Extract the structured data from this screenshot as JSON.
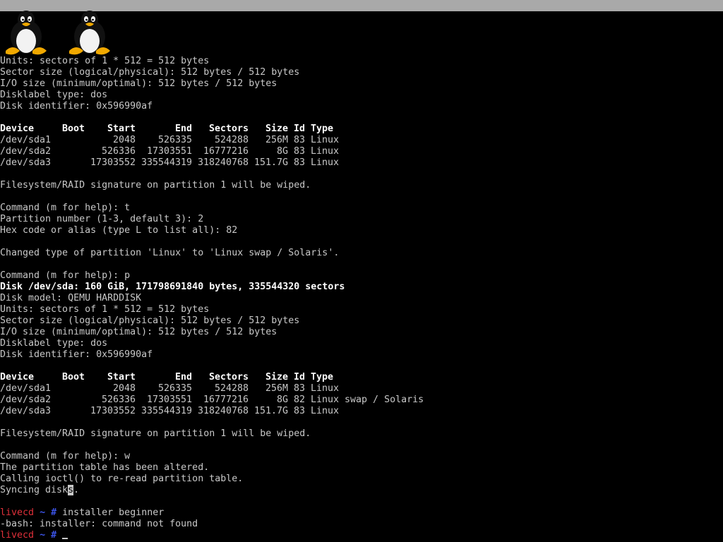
{
  "logos": [
    "tux-icon",
    "tux-icon"
  ],
  "block1": {
    "units": "Units: sectors of 1 * 512 = 512 bytes",
    "sector_size": "Sector size (logical/physical): 512 bytes / 512 bytes",
    "io_size": "I/O size (minimum/optimal): 512 bytes / 512 bytes",
    "disklabel": "Disklabel type: dos",
    "identifier": "Disk identifier: 0x596990af"
  },
  "table_header": {
    "device": "Device",
    "boot": "Boot",
    "start": "Start",
    "end": "End",
    "sectors": "Sectors",
    "size": "Size",
    "id": "Id",
    "type": "Type"
  },
  "table1": [
    {
      "device": "/dev/sda1",
      "start": "2048",
      "end": "526335",
      "sectors": "524288",
      "size": "256M",
      "id": "83",
      "type": "Linux"
    },
    {
      "device": "/dev/sda2",
      "start": "526336",
      "end": "17303551",
      "sectors": "16777216",
      "size": "8G",
      "id": "83",
      "type": "Linux"
    },
    {
      "device": "/dev/sda3",
      "start": "17303552",
      "end": "335544319",
      "sectors": "318240768",
      "size": "151.7G",
      "id": "83",
      "type": "Linux"
    }
  ],
  "wipe_note": "Filesystem/RAID signature on partition 1 will be wiped.",
  "cmd_t": "Command (m for help): t",
  "part_num": "Partition number (1-3, default 3): 2",
  "hex_code": "Hex code or alias (type L to list all): 82",
  "changed_type": "Changed type of partition 'Linux' to 'Linux swap / Solaris'.",
  "cmd_p": "Command (m for help): p",
  "disk_line": "Disk /dev/sda: 160 GiB, 171798691840 bytes, 335544320 sectors",
  "disk_model": "Disk model: QEMU HARDDISK",
  "table2": [
    {
      "device": "/dev/sda1",
      "start": "2048",
      "end": "526335",
      "sectors": "524288",
      "size": "256M",
      "id": "83",
      "type": "Linux"
    },
    {
      "device": "/dev/sda2",
      "start": "526336",
      "end": "17303551",
      "sectors": "16777216",
      "size": "8G",
      "id": "82",
      "type": "Linux swap / Solaris"
    },
    {
      "device": "/dev/sda3",
      "start": "17303552",
      "end": "335544319",
      "sectors": "318240768",
      "size": "151.7G",
      "id": "83",
      "type": "Linux"
    }
  ],
  "cmd_w": "Command (m for help): w",
  "altered": "The partition table has been altered.",
  "ioctl": "Calling ioctl() to re-read partition table.",
  "syncing_pre": "Syncing disk",
  "syncing_cursor": "s",
  "syncing_post": ".",
  "prompt": {
    "host": "livecd",
    "tilde": "~",
    "hash": "#"
  },
  "cmd_installer": "installer beginner",
  "bash_error": "-bash: installer: command not found",
  "colors": {
    "background": "#000000",
    "text": "#c8c8c8",
    "prompt_host": "#e0303a",
    "prompt_path": "#3c54e8",
    "topbar": "#a9a9a9"
  }
}
